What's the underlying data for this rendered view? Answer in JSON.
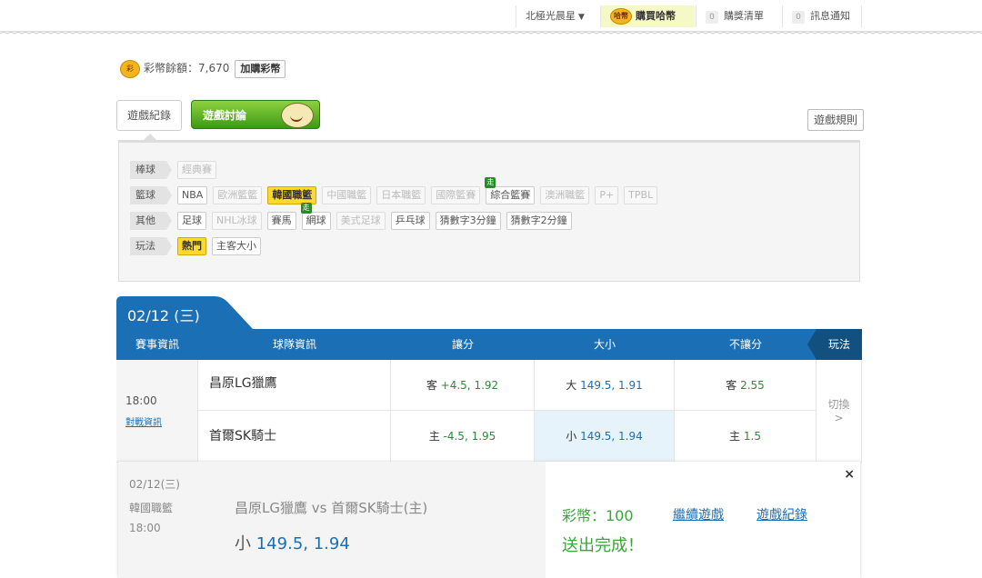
{
  "topbar": {
    "user": "北極光晨星",
    "buy_coin": "購買哈幣",
    "cart_count": "0",
    "cart": "購獎清單",
    "notify_count": "0",
    "notify": "訊息通知",
    "coin_icon_text": "哈幣"
  },
  "balance": {
    "label": "彩幣餘額：",
    "value": "7,670",
    "buy_button": "加購彩幣",
    "icon_text": "彩"
  },
  "tabs": {
    "record": "遊戲紀錄",
    "discuss": "遊戲討論",
    "rules": "遊戲規則"
  },
  "filters": {
    "rows": [
      {
        "category": "棒球",
        "chips": [
          {
            "label": "經典賽",
            "state": "disabled"
          }
        ]
      },
      {
        "category": "籃球",
        "chips": [
          {
            "label": "NBA",
            "state": "normal"
          },
          {
            "label": "歐洲籃籃",
            "state": "disabled"
          },
          {
            "label": "韓國職籃",
            "state": "active"
          },
          {
            "label": "中國職籃",
            "state": "disabled"
          },
          {
            "label": "日本職籃",
            "state": "disabled"
          },
          {
            "label": "國際籃賽",
            "state": "disabled"
          },
          {
            "label": "綜合籃賽",
            "state": "normal",
            "live": "走"
          },
          {
            "label": "澳洲職籃",
            "state": "disabled"
          },
          {
            "label": "P+",
            "state": "disabled"
          },
          {
            "label": "TPBL",
            "state": "disabled"
          }
        ]
      },
      {
        "category": "其他",
        "chips": [
          {
            "label": "足球",
            "state": "normal"
          },
          {
            "label": "NHL冰球",
            "state": "disabled"
          },
          {
            "label": "賽馬",
            "state": "normal"
          },
          {
            "label": "網球",
            "state": "normal",
            "live": "走"
          },
          {
            "label": "美式足球",
            "state": "disabled"
          },
          {
            "label": "乒乓球",
            "state": "normal"
          },
          {
            "label": "猜數字3分鐘",
            "state": "normal"
          },
          {
            "label": "猜數字2分鐘",
            "state": "normal"
          }
        ]
      },
      {
        "category": "玩法",
        "chips": [
          {
            "label": "熱門",
            "state": "active"
          },
          {
            "label": "主客大小",
            "state": "normal"
          }
        ]
      }
    ]
  },
  "date_tab": "02/12 (三)",
  "table": {
    "headers": [
      "賽事資訊",
      "球隊資訊",
      "讓分",
      "大小",
      "不讓分",
      "玩法"
    ],
    "time": "18:00",
    "info_link": "對戰資訊",
    "switch": "切換",
    "switch_arrow": ">",
    "rows": [
      {
        "team": "昌原LG獵鷹",
        "spread_tag": "客",
        "spread": "+4.5, 1.92",
        "total_tag": "大",
        "total": "149.5, 1.91",
        "ml_tag": "客",
        "ml": "2.55"
      },
      {
        "team": "首爾SK騎士",
        "spread_tag": "主",
        "spread": "-4.5, 1.95",
        "total_tag": "小",
        "total": "149.5, 1.94",
        "ml_tag": "主",
        "ml": "1.5"
      }
    ]
  },
  "slip": {
    "date": "02/12(三)",
    "league": "韓國職籃",
    "time": "18:00",
    "match": "昌原LG獵鷹  vs  首爾SK騎士(主)",
    "pick_tag": "小",
    "pick_value": "149.5, 1.94",
    "coin": "彩幣：100",
    "done": "送出完成！",
    "continue": "繼續遊戲",
    "record": "遊戲紀錄",
    "close": "×"
  }
}
